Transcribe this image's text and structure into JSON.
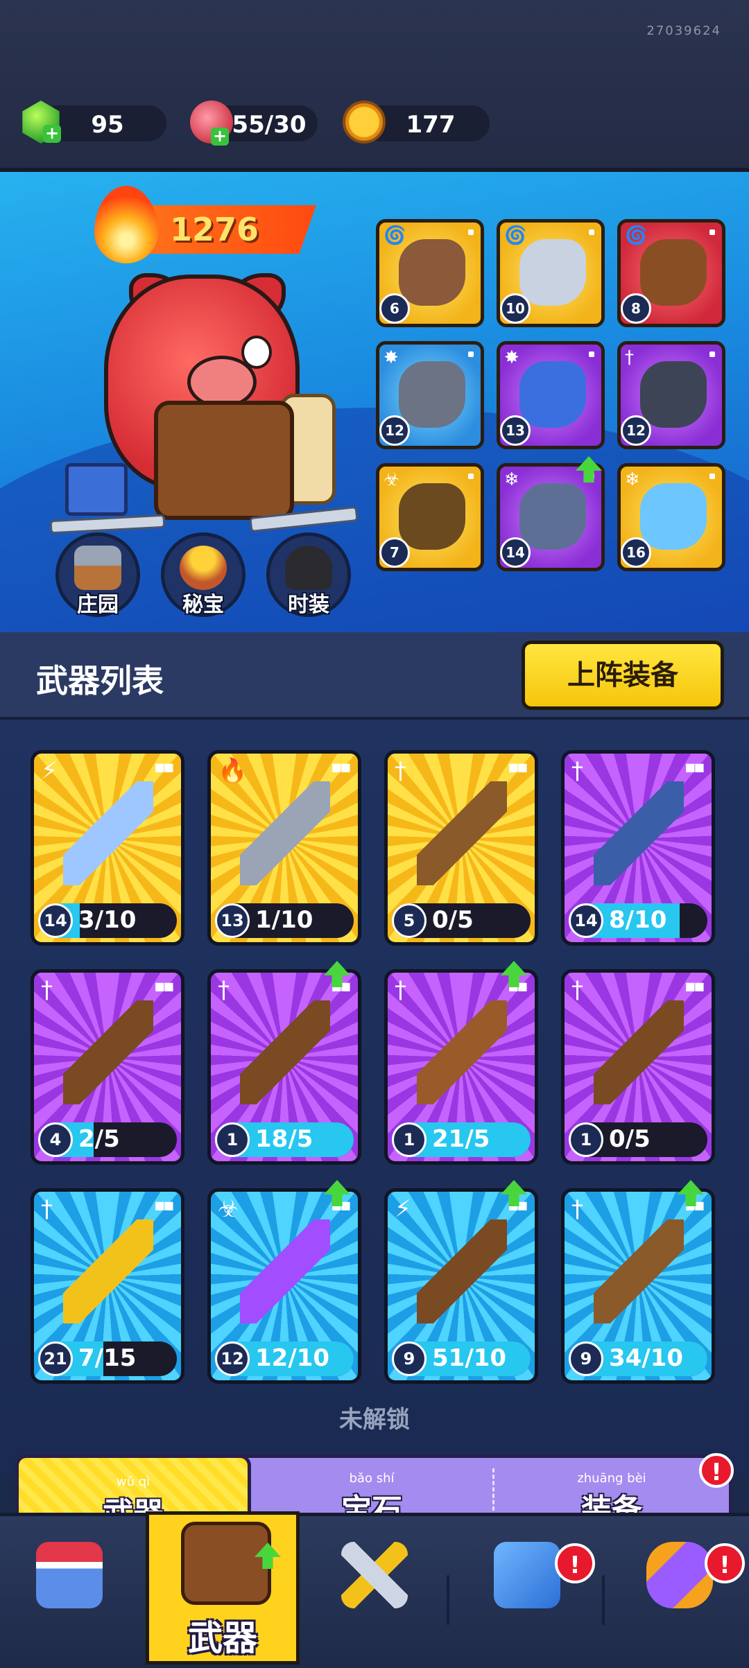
{
  "build_id": "27039624",
  "resources": [
    {
      "name": "gem",
      "value": "95",
      "color": "#3fbf2f"
    },
    {
      "name": "meat",
      "value": "55/30",
      "color": "#d23a4c"
    },
    {
      "name": "coin",
      "value": "177",
      "color": "#ffc52a"
    }
  ],
  "hero": {
    "power": "1276",
    "buttons": [
      {
        "label": "庄园",
        "icon": "manor-icon"
      },
      {
        "label": "秘宝",
        "icon": "treasure-pot-icon"
      },
      {
        "label": "时装",
        "icon": "fedora-hat-icon"
      }
    ]
  },
  "equipped": [
    {
      "icon": "bell-icon",
      "rarity": "yellow",
      "level": "6",
      "badge": "tornado"
    },
    {
      "icon": "feather-icon",
      "rarity": "yellow",
      "level": "10",
      "badge": "tornado"
    },
    {
      "icon": "spellbook-icon",
      "rarity": "red",
      "level": "8",
      "badge": "tornado"
    },
    {
      "icon": "gauntlet-icon",
      "rarity": "blue",
      "level": "12",
      "badge": "burst"
    },
    {
      "icon": "wizard-hat-icon",
      "rarity": "purple",
      "level": "13",
      "badge": "burst"
    },
    {
      "icon": "shuriken-icon",
      "rarity": "purple",
      "level": "12",
      "badge": "sword"
    },
    {
      "icon": "poison-dagger-icon",
      "rarity": "yellow",
      "level": "7",
      "badge": "toxic"
    },
    {
      "icon": "frost-wand-icon",
      "rarity": "purple",
      "level": "14",
      "badge": "snowflake",
      "upgrade": true
    },
    {
      "icon": "ice-crystal-icon",
      "rarity": "yellow",
      "level": "16",
      "badge": "snowflake"
    }
  ],
  "weapon_list": {
    "title": "武器列表",
    "equip_button": "上阵装备",
    "locked_label": "未解锁",
    "cards": [
      {
        "icon": "lightning-staff-icon",
        "rarity": "yellow",
        "level": "14",
        "progress": "3/10",
        "fill": 0.3,
        "badge": "lightning"
      },
      {
        "icon": "hook-blade-icon",
        "rarity": "yellow",
        "level": "13",
        "progress": "1/10",
        "fill": 0.1,
        "badge": "fire"
      },
      {
        "icon": "hand-cannon-icon",
        "rarity": "yellow",
        "level": "5",
        "progress": "0/5",
        "fill": 0,
        "badge": "sword"
      },
      {
        "icon": "flintlock-pistol-icon",
        "rarity": "purple",
        "level": "14",
        "progress": "8/10",
        "fill": 0.8,
        "badge": "sword"
      },
      {
        "icon": "rake-icon",
        "rarity": "purple",
        "level": "4",
        "progress": "2/5",
        "fill": 0.4,
        "badge": "sword"
      },
      {
        "icon": "crossbow-icon",
        "rarity": "purple",
        "level": "1",
        "progress": "18/5",
        "fill": 1,
        "badge": "sword",
        "upgrade": true
      },
      {
        "icon": "boomerang-icon",
        "rarity": "purple",
        "level": "1",
        "progress": "21/5",
        "fill": 1,
        "badge": "sword",
        "upgrade": true
      },
      {
        "icon": "longbow-icon",
        "rarity": "purple",
        "level": "1",
        "progress": "0/5",
        "fill": 0,
        "badge": "sword"
      },
      {
        "icon": "golden-dagger-icon",
        "rarity": "blue",
        "level": "21",
        "progress": "7/15",
        "fill": 0.47,
        "badge": "sword"
      },
      {
        "icon": "potion-icon",
        "rarity": "blue",
        "level": "12",
        "progress": "12/10",
        "fill": 1,
        "badge": "toxic",
        "upgrade": true
      },
      {
        "icon": "nunchaku-icon",
        "rarity": "blue",
        "level": "9",
        "progress": "51/10",
        "fill": 1,
        "badge": "lightning",
        "upgrade": true
      },
      {
        "icon": "wooden-sword-icon",
        "rarity": "blue",
        "level": "9",
        "progress": "34/10",
        "fill": 1,
        "badge": "sword",
        "upgrade": true
      }
    ]
  },
  "category_tabs": [
    {
      "pinyin": "wǔ qì",
      "label": "武器",
      "active": true
    },
    {
      "pinyin": "bǎo shí",
      "label": "宝石",
      "active": false
    },
    {
      "pinyin": "zhuāng bèi",
      "label": "装备",
      "active": false,
      "alert": "!"
    }
  ],
  "bottom_nav": [
    {
      "icon": "shop-icon"
    },
    {
      "icon": "weapon-bag-icon",
      "label": "武器",
      "active": true
    },
    {
      "icon": "crossed-swords-icon"
    },
    {
      "icon": "map-icon",
      "alert": "!"
    },
    {
      "icon": "capsule-icon",
      "alert": "!"
    }
  ],
  "colors": {
    "accent_yellow": "#ffd21e",
    "card_purple": "#9a37e3",
    "card_blue": "#1d9fe6",
    "alert_red": "#e8192c"
  }
}
